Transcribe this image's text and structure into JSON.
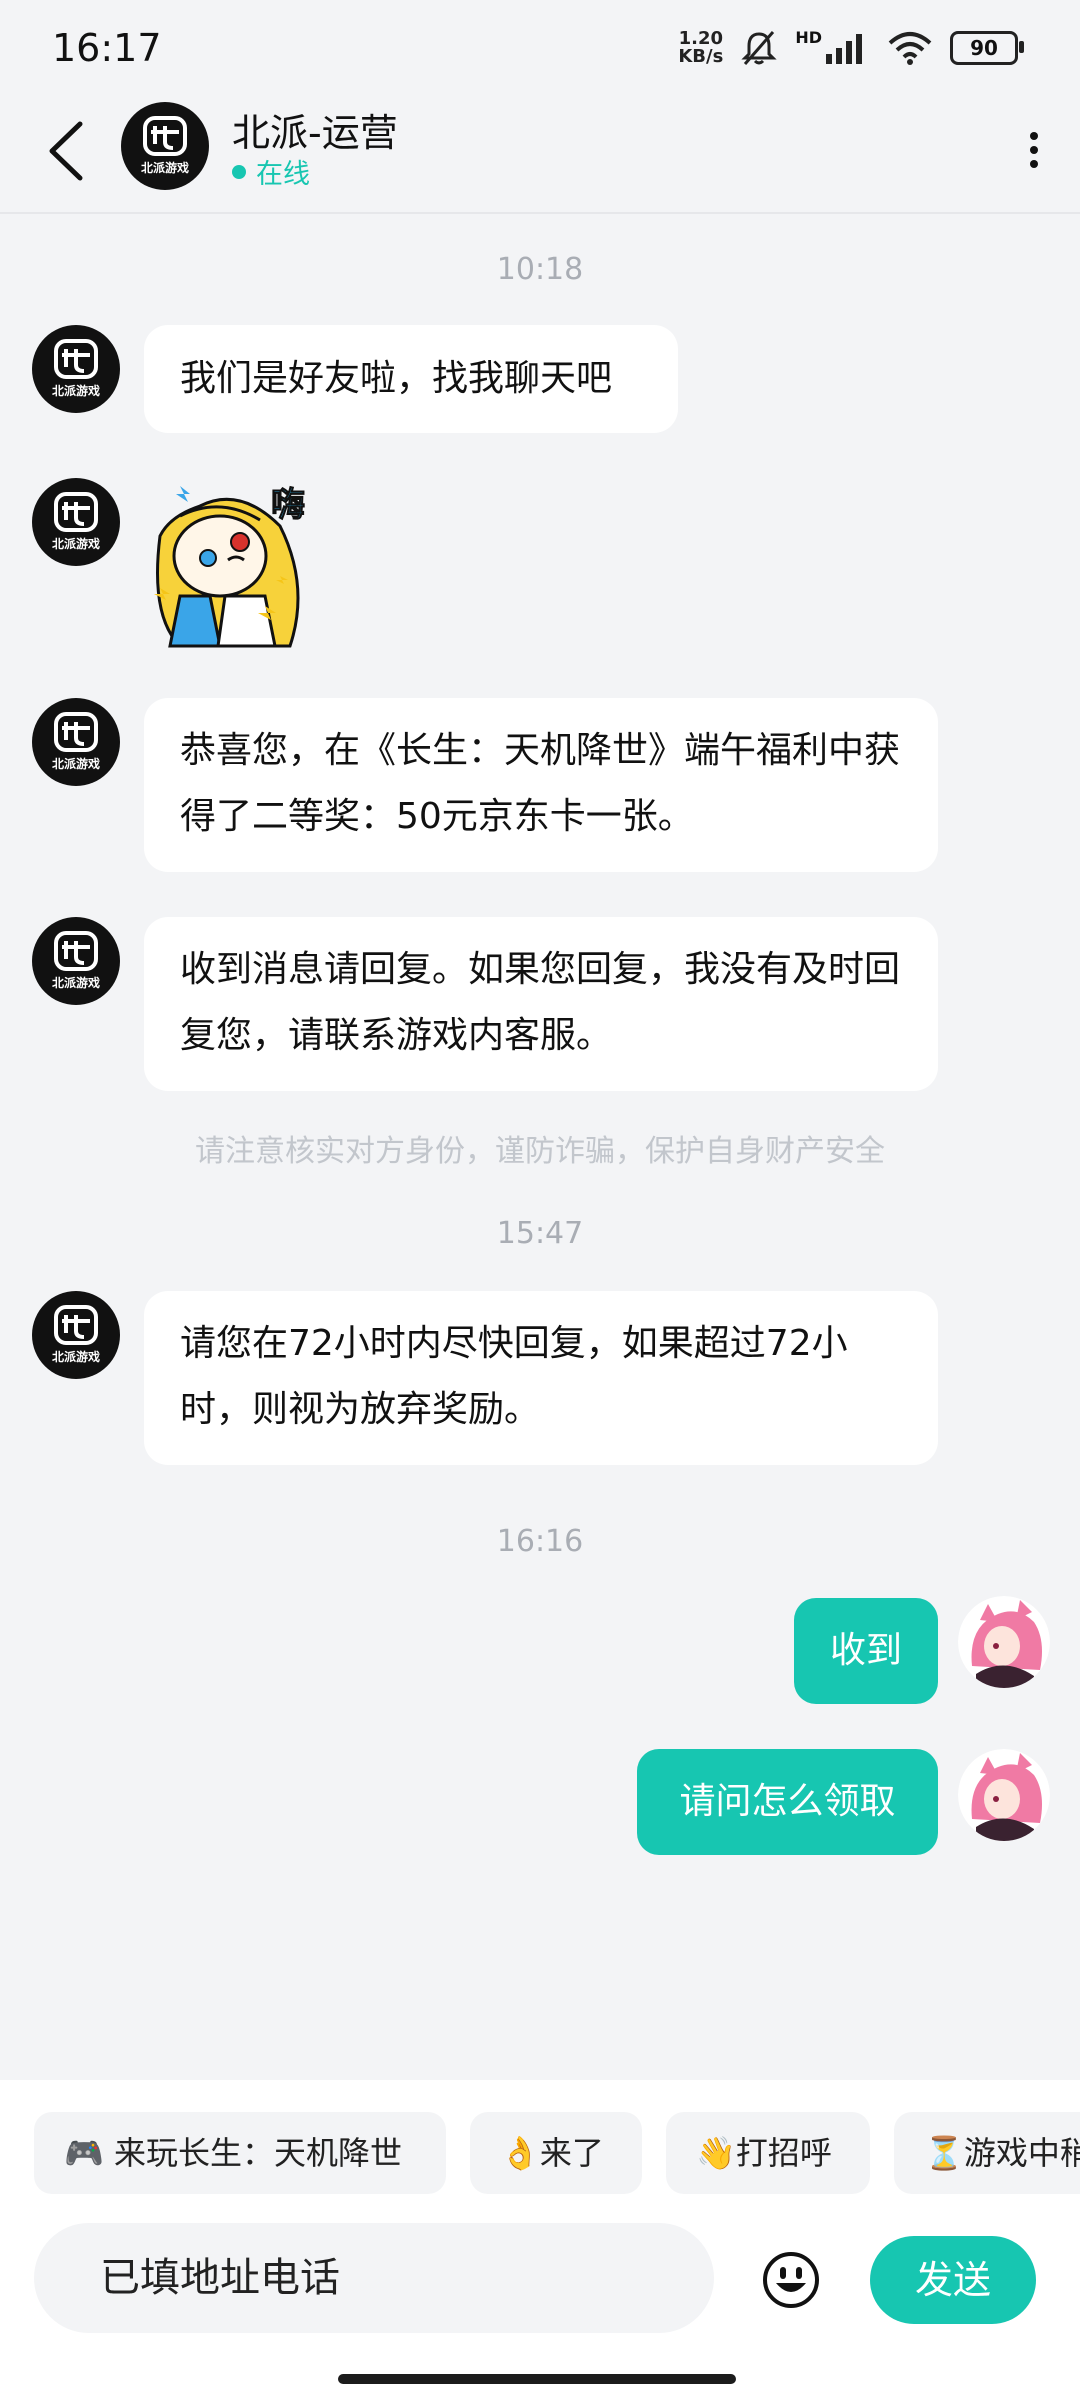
{
  "status_bar": {
    "time": "16:17",
    "speed_value": "1.20",
    "speed_unit": "KB/s",
    "network": "HD",
    "battery": "90"
  },
  "header": {
    "title": "北派-运营",
    "status": "在线",
    "avatar_text": "北派游戏"
  },
  "chat": {
    "timestamps": [
      "10:18",
      "15:47",
      "16:16"
    ],
    "incoming": [
      "我们是好友啦，找我聊天吧",
      "恭喜您，在《长生：天机降世》端午福利中获得了二等奖：50元京东卡一张。",
      "收到消息请回复。如果您回复，我没有及时回复您，请联系游戏内客服。",
      "请您在72小时内尽快回复，如果超过72小时，则视为放弃奖励。"
    ],
    "sticker_text": "嗨",
    "warning": "请注意核实对方身份，谨防诈骗，保护自身财产安全",
    "outgoing": [
      "收到",
      "请问怎么领取"
    ]
  },
  "quick_replies": [
    "🎮 来玩长生：天机降世",
    "👌来了",
    "👋打招呼",
    "⏳游戏中稍"
  ],
  "input": {
    "value": "已填地址电话"
  },
  "send_label": "发送",
  "colors": {
    "accent": "#17c6b1",
    "background": "#f3f4f6"
  }
}
